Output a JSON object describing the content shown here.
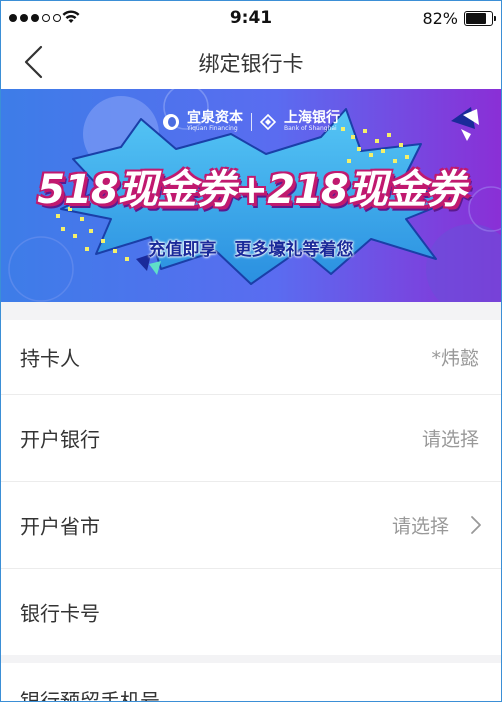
{
  "status_bar": {
    "time": "9:41",
    "battery": "82%",
    "battery_level": 0.82,
    "signal_bars": 5,
    "signal_filled": 3
  },
  "nav": {
    "title": "绑定银行卡",
    "back_icon": "chevron-left-icon"
  },
  "banner": {
    "brand1_name": "宜泉资本",
    "brand1_sub": "Yiquan Financing",
    "brand2_name": "上海银行",
    "brand2_sub": "Bank of Shanghai",
    "headline": "518现金券+218现金券",
    "tagline_left": "充值即享",
    "tagline_right": "更多壕礼等着您",
    "colors": {
      "gradient_start": "#3a7be6",
      "gradient_end": "#8a2fd6",
      "burst": "#39b3f0",
      "headline_stroke": "#c1196f"
    }
  },
  "form": {
    "rows": [
      {
        "label": "持卡人",
        "value": "*炜懿",
        "has_chevron": false
      },
      {
        "label": "开户银行",
        "value": "请选择",
        "has_chevron": false
      },
      {
        "label": "开户省市",
        "value": "请选择",
        "has_chevron": true
      },
      {
        "label": "银行卡号",
        "value": "",
        "has_chevron": false
      }
    ],
    "next_label": "银行预留手机号"
  }
}
